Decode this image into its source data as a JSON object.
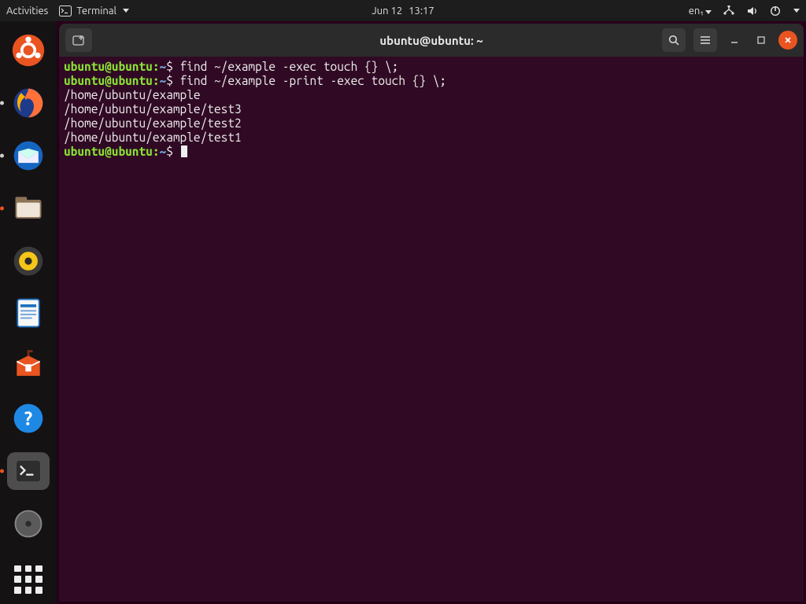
{
  "topbar": {
    "activities": "Activities",
    "app_name": "Terminal",
    "date": "Jun 12",
    "time": "13:17",
    "lang": "en₁"
  },
  "dock": {
    "items": [
      {
        "name": "ubuntu-logo"
      },
      {
        "name": "firefox"
      },
      {
        "name": "thunderbird"
      },
      {
        "name": "files"
      },
      {
        "name": "rhythmbox"
      },
      {
        "name": "libreoffice-writer"
      },
      {
        "name": "ubuntu-software"
      },
      {
        "name": "help"
      },
      {
        "name": "terminal"
      },
      {
        "name": "disk-utility"
      }
    ]
  },
  "window": {
    "title": "ubuntu@ubuntu: ~",
    "prompt_userhost": "ubuntu@ubuntu",
    "prompt_sep": ":",
    "prompt_path": "~",
    "prompt_symbol": "$",
    "lines": [
      {
        "type": "prompt",
        "cmd": "find ~/example -exec touch {} \\;"
      },
      {
        "type": "prompt",
        "cmd": "find ~/example -print -exec touch {} \\;"
      },
      {
        "type": "out",
        "text": "/home/ubuntu/example"
      },
      {
        "type": "out",
        "text": "/home/ubuntu/example/test3"
      },
      {
        "type": "out",
        "text": "/home/ubuntu/example/test2"
      },
      {
        "type": "out",
        "text": "/home/ubuntu/example/test1"
      },
      {
        "type": "prompt",
        "cmd": ""
      }
    ]
  }
}
